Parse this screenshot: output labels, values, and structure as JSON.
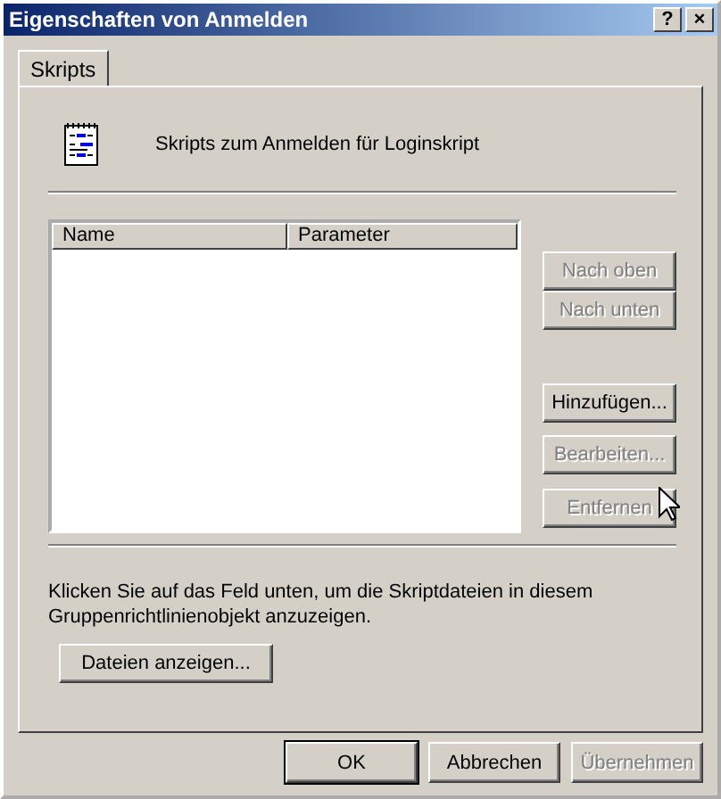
{
  "window": {
    "title": "Eigenschaften von Anmelden",
    "title_buttons": [
      "?",
      "×"
    ]
  },
  "tabs": [
    {
      "label": "Skripts",
      "selected": true
    }
  ],
  "header": {
    "text": "Skripts zum Anmelden für Loginskript"
  },
  "table": {
    "columns": [
      "Name",
      "Parameter"
    ]
  },
  "side_buttons": [
    {
      "label": "Nach oben",
      "disabled": true
    },
    {
      "label": "Nach unten",
      "disabled": true
    },
    {
      "label": "Hinzufügen...",
      "disabled": false
    },
    {
      "label": "Bearbeiten...",
      "disabled": true
    },
    {
      "label": "Entfernen",
      "disabled": true
    }
  ],
  "info_text": "Klicken Sie auf das Feld unten, um die Skriptdateien in diesem Gruppenrichtlinienobjekt anzuzeigen.",
  "show_files_button": {
    "label": "Dateien anzeigen..."
  },
  "dialog_buttons": [
    {
      "label": "OK",
      "disabled": false,
      "default": true
    },
    {
      "label": "Abbrechen",
      "disabled": false,
      "default": false
    },
    {
      "label": "Übernehmen",
      "disabled": true,
      "default": false
    }
  ]
}
